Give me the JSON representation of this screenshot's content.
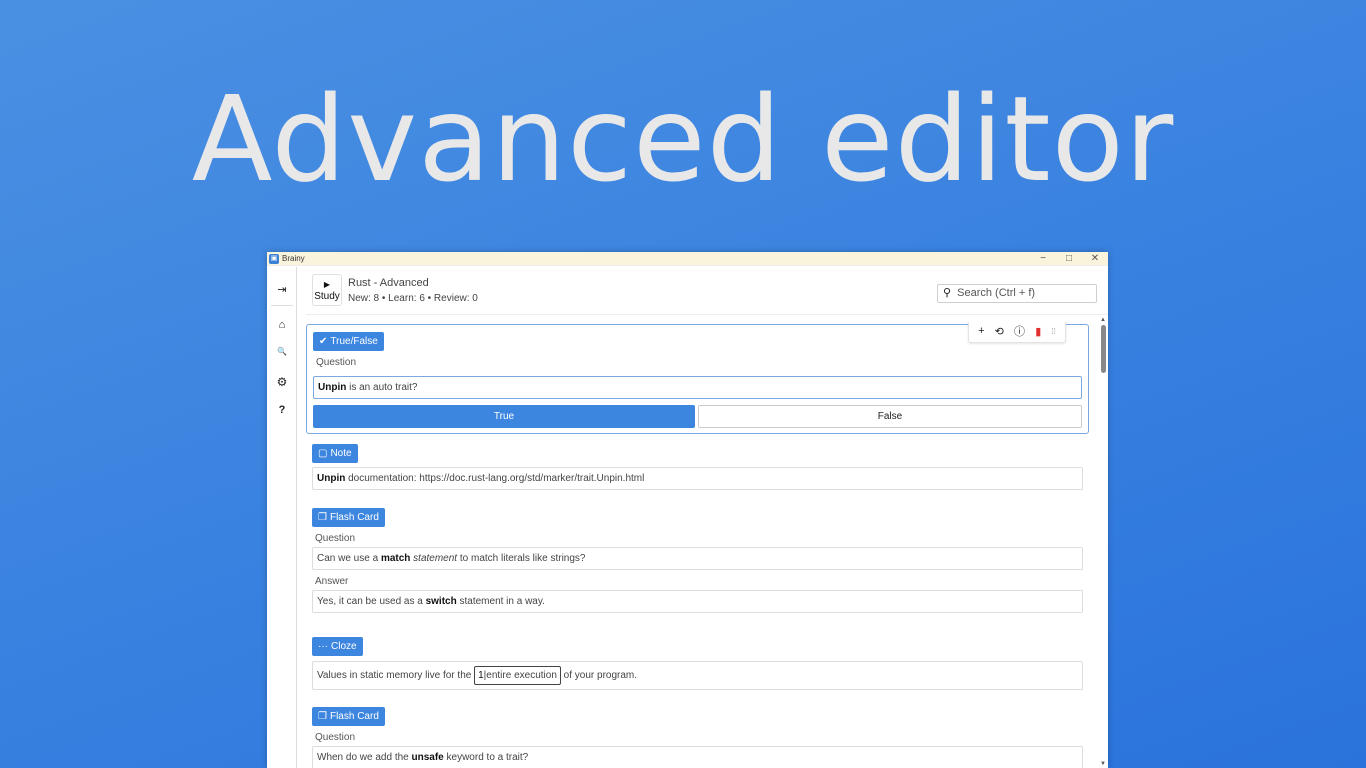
{
  "headline": "Advanced editor",
  "window": {
    "app_name": "Brainy",
    "app_icon_glyph": "▣",
    "controls": {
      "minimize": "−",
      "maximize": "□",
      "close": "✕"
    }
  },
  "sidebar": {
    "collapse_icon": "⇥",
    "items": [
      {
        "icon": "home-icon",
        "glyph": "⌂"
      },
      {
        "icon": "search-icon",
        "glyph": "🔍"
      },
      {
        "icon": "gear-icon",
        "glyph": "⚙"
      },
      {
        "icon": "help-icon",
        "glyph": "?"
      }
    ]
  },
  "header": {
    "study_play_glyph": "▶",
    "study_label": "Study",
    "deck_title": "Rust - Advanced",
    "stats": "New: 8 • Learn: 6 • Review: 0",
    "search_placeholder": "Search (Ctrl + f)"
  },
  "toolbar": {
    "add": "+",
    "reset": "⟲",
    "info": "ⓘ",
    "delete": "🗑",
    "grip": "⠀⣿"
  },
  "cards": {
    "truefalse": {
      "badge": "True/False",
      "badge_glyph": "✔",
      "question_label": "Question",
      "question_bold": "Unpin",
      "question_rest": " is an auto trait?",
      "true_label": "True",
      "false_label": "False"
    },
    "note": {
      "badge": "Note",
      "badge_glyph": "🗋",
      "text_bold": "Unpin",
      "text_rest": " documentation: https://doc.rust-lang.org/std/marker/trait.Unpin.html"
    },
    "flash1": {
      "badge": "Flash Card",
      "badge_glyph": "❐",
      "question_label": "Question",
      "q_part1": "Can we use a ",
      "q_bold": "match",
      "q_italic": "statement",
      "q_part2": " to match literals like strings?",
      "answer_label": "Answer",
      "a_part1": "Yes, it can be used as a ",
      "a_bold": "switch",
      "a_part2": " statement in a way."
    },
    "cloze": {
      "badge": "Cloze",
      "badge_glyph": "…",
      "text_before": "Values in static memory live for the ",
      "cloze_index": "1",
      "cloze_text": "entire execution",
      "text_after": " of your program."
    },
    "flash2": {
      "badge": "Flash Card",
      "badge_glyph": "❐",
      "question_label": "Question",
      "q_part1": "When do we add the ",
      "q_bold": "unsafe",
      "q_part2": " keyword to a trait?"
    }
  },
  "colors": {
    "accent": "#3d86df",
    "background": "#3a82e0",
    "delete": "#e03030"
  }
}
